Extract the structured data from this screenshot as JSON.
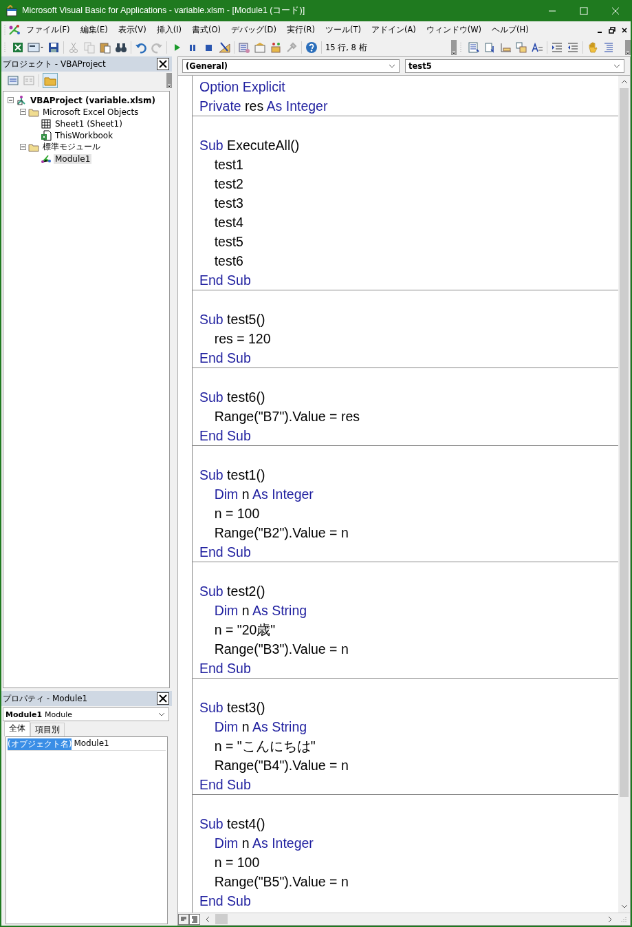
{
  "window": {
    "title": "Microsoft Visual Basic for Applications - variable.xlsm - [Module1 (コード)]"
  },
  "menu": [
    {
      "label": "ファイル(F)"
    },
    {
      "label": "編集(E)"
    },
    {
      "label": "表示(V)"
    },
    {
      "label": "挿入(I)"
    },
    {
      "label": "書式(O)"
    },
    {
      "label": "デバッグ(D)"
    },
    {
      "label": "実行(R)"
    },
    {
      "label": "ツール(T)"
    },
    {
      "label": "アドイン(A)"
    },
    {
      "label": "ウィンドウ(W)"
    },
    {
      "label": "ヘルプ(H)"
    }
  ],
  "toolbar": {
    "position": "15 行, 8 桁"
  },
  "project": {
    "title": "プロジェクト - VBAProject",
    "tree": [
      {
        "label": "VBAProject (variable.xlsm)",
        "kind": "project",
        "expanded": true,
        "selected": false,
        "children": [
          {
            "label": "Microsoft Excel Objects",
            "kind": "folder",
            "expanded": true,
            "selected": false,
            "children": [
              {
                "label": "Sheet1 (Sheet1)",
                "kind": "sheet",
                "selected": false
              },
              {
                "label": "ThisWorkbook",
                "kind": "workbook",
                "selected": false
              }
            ]
          },
          {
            "label": "標準モジュール",
            "kind": "folder",
            "expanded": true,
            "selected": false,
            "children": [
              {
                "label": "Module1",
                "kind": "module",
                "selected": true
              }
            ]
          }
        ]
      }
    ]
  },
  "properties": {
    "title": "プロパティ - Module1",
    "object": {
      "name": "Module1",
      "type": "Module"
    },
    "tabs": [
      {
        "label": "全体",
        "selected": true
      },
      {
        "label": "項目別",
        "selected": false
      }
    ],
    "rows": [
      {
        "name": "(オブジェクト名)",
        "value": "Module1",
        "selected": true
      }
    ]
  },
  "code": {
    "object": "(General)",
    "procedure": "test5",
    "procedures": [
      {
        "lines": [
          {
            "tokens": [
              {
                "text": "Option Explicit",
                "kw": true
              }
            ]
          },
          {
            "tokens": [
              {
                "text": "Private",
                "kw": true
              },
              {
                "text": " res ",
                "kw": false
              },
              {
                "text": "As Integer",
                "kw": true
              }
            ]
          }
        ]
      },
      {
        "lines": [
          {
            "tokens": [
              {
                "text": "Sub",
                "kw": true
              },
              {
                "text": " ExecuteAll()",
                "kw": false
              }
            ]
          },
          {
            "tokens": [
              {
                "text": "    test1",
                "kw": false
              }
            ]
          },
          {
            "tokens": [
              {
                "text": "    test2",
                "kw": false
              }
            ]
          },
          {
            "tokens": [
              {
                "text": "    test3",
                "kw": false
              }
            ]
          },
          {
            "tokens": [
              {
                "text": "    test4",
                "kw": false
              }
            ]
          },
          {
            "tokens": [
              {
                "text": "    test5",
                "kw": false
              }
            ]
          },
          {
            "tokens": [
              {
                "text": "    test6",
                "kw": false
              }
            ]
          },
          {
            "tokens": [
              {
                "text": "End Sub",
                "kw": true
              }
            ]
          }
        ]
      },
      {
        "lines": [
          {
            "tokens": [
              {
                "text": "Sub",
                "kw": true
              },
              {
                "text": " test5()",
                "kw": false
              }
            ]
          },
          {
            "tokens": [
              {
                "text": "    res = 120",
                "kw": false
              }
            ]
          },
          {
            "tokens": [
              {
                "text": "End Sub",
                "kw": true
              }
            ]
          }
        ]
      },
      {
        "lines": [
          {
            "tokens": [
              {
                "text": "Sub",
                "kw": true
              },
              {
                "text": " test6()",
                "kw": false
              }
            ]
          },
          {
            "tokens": [
              {
                "text": "    Range(\"B7\").Value = res",
                "kw": false
              }
            ]
          },
          {
            "tokens": [
              {
                "text": "End Sub",
                "kw": true
              }
            ]
          }
        ]
      },
      {
        "lines": [
          {
            "tokens": [
              {
                "text": "Sub",
                "kw": true
              },
              {
                "text": " test1()",
                "kw": false
              }
            ]
          },
          {
            "tokens": [
              {
                "text": "    Dim",
                "kw": true
              },
              {
                "text": " n ",
                "kw": false
              },
              {
                "text": "As Integer",
                "kw": true
              }
            ]
          },
          {
            "tokens": [
              {
                "text": "    n = 100",
                "kw": false
              }
            ]
          },
          {
            "tokens": [
              {
                "text": "    Range(\"B2\").Value = n",
                "kw": false
              }
            ]
          },
          {
            "tokens": [
              {
                "text": "End Sub",
                "kw": true
              }
            ]
          }
        ]
      },
      {
        "lines": [
          {
            "tokens": [
              {
                "text": "Sub",
                "kw": true
              },
              {
                "text": " test2()",
                "kw": false
              }
            ]
          },
          {
            "tokens": [
              {
                "text": "    Dim",
                "kw": true
              },
              {
                "text": " n ",
                "kw": false
              },
              {
                "text": "As String",
                "kw": true
              }
            ]
          },
          {
            "tokens": [
              {
                "text": "    n = \"20歳\"",
                "kw": false
              }
            ]
          },
          {
            "tokens": [
              {
                "text": "    Range(\"B3\").Value = n",
                "kw": false
              }
            ]
          },
          {
            "tokens": [
              {
                "text": "End Sub",
                "kw": true
              }
            ]
          }
        ]
      },
      {
        "lines": [
          {
            "tokens": [
              {
                "text": "Sub",
                "kw": true
              },
              {
                "text": " test3()",
                "kw": false
              }
            ]
          },
          {
            "tokens": [
              {
                "text": "    Dim",
                "kw": true
              },
              {
                "text": " n ",
                "kw": false
              },
              {
                "text": "As String",
                "kw": true
              }
            ]
          },
          {
            "tokens": [
              {
                "text": "    n = \"こんにちは\"",
                "kw": false
              }
            ]
          },
          {
            "tokens": [
              {
                "text": "    Range(\"B4\").Value = n",
                "kw": false
              }
            ]
          },
          {
            "tokens": [
              {
                "text": "End Sub",
                "kw": true
              }
            ]
          }
        ]
      },
      {
        "lines": [
          {
            "tokens": [
              {
                "text": "Sub",
                "kw": true
              },
              {
                "text": " test4()",
                "kw": false
              }
            ]
          },
          {
            "tokens": [
              {
                "text": "    Dim",
                "kw": true
              },
              {
                "text": " n ",
                "kw": false
              },
              {
                "text": "As Integer",
                "kw": true
              }
            ]
          },
          {
            "tokens": [
              {
                "text": "    n = 100",
                "kw": false
              }
            ]
          },
          {
            "tokens": [
              {
                "text": "    Range(\"B5\").Value = n",
                "kw": false
              }
            ]
          },
          {
            "tokens": [
              {
                "text": "End Sub",
                "kw": true
              }
            ]
          }
        ]
      }
    ]
  }
}
